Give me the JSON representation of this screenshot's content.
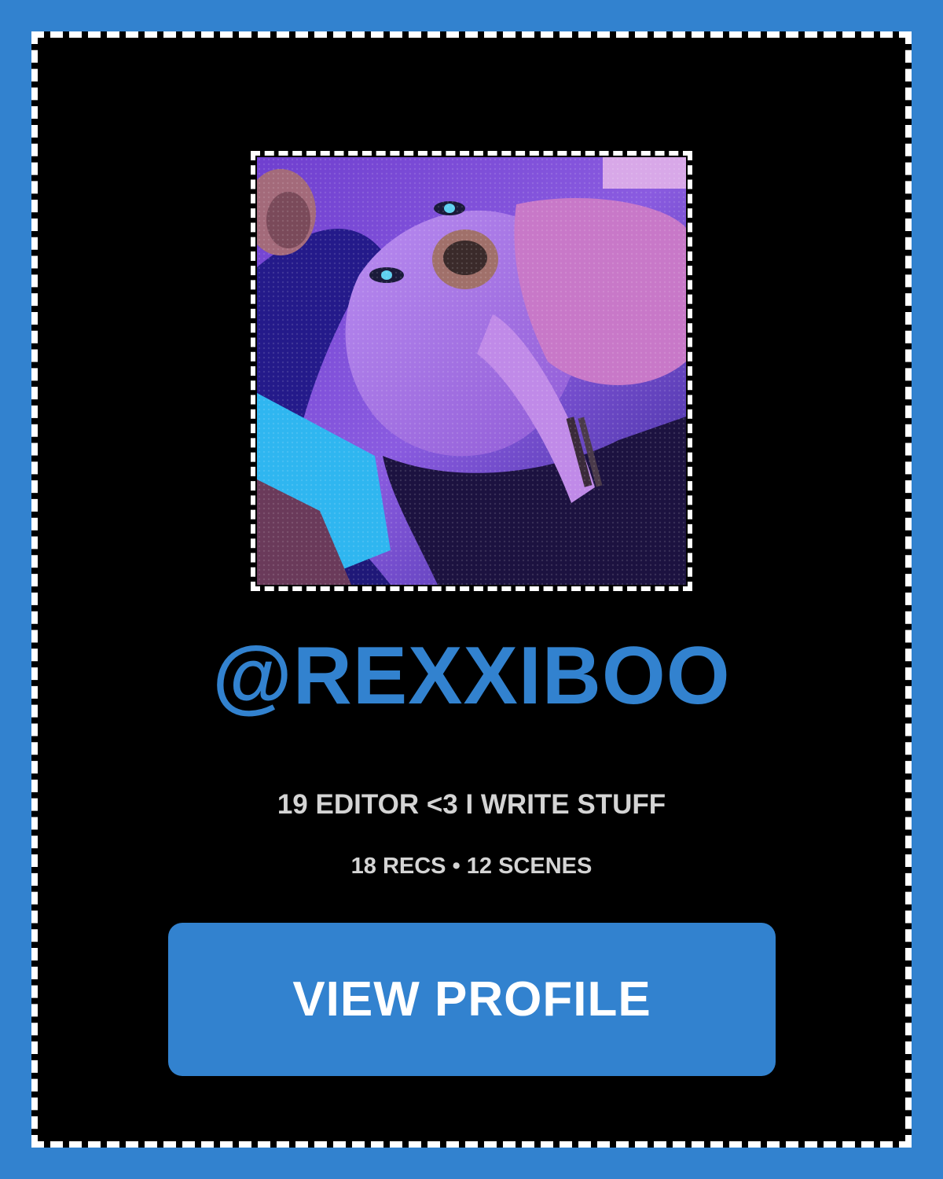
{
  "profile": {
    "username": "@REXXIBOO",
    "bio": "19 EDITOR <3 I WRITE STUFF",
    "stats": "18 RECS • 12 SCENES",
    "avatar_alt": "profile photo"
  },
  "actions": {
    "view_profile_label": "VIEW PROFILE"
  },
  "colors": {
    "background": "#3282cf",
    "card": "#000000",
    "accent": "#3282cf",
    "text_muted": "#d4d4d4",
    "border": "#ffffff"
  }
}
